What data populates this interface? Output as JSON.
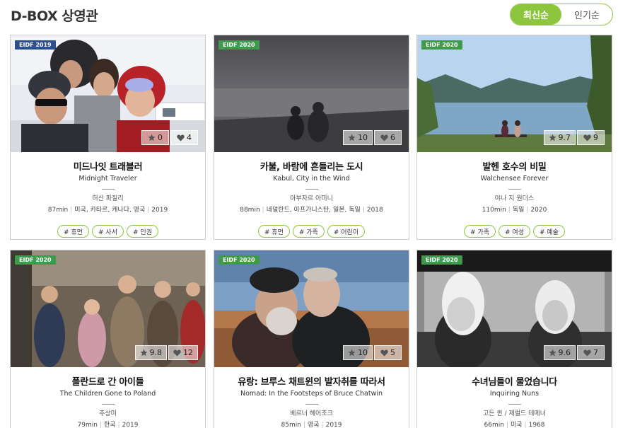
{
  "page": {
    "title": "D-BOX 상영관"
  },
  "sort": {
    "latest": "최신순",
    "popular": "인기순",
    "accent": "#8cc63f"
  },
  "cards": [
    {
      "badge": "EIDF 2019",
      "star": "0",
      "heart": "4",
      "title_ko": "미드나잇 트래블러",
      "title_en": "Midnight Traveler",
      "director": "허산 파질리",
      "runtime": "87min",
      "countries": "미국, 카타르, 캐나다, 영국",
      "year": "2019",
      "tags": [
        "# 휴먼",
        "# 사서",
        "# 인권"
      ]
    },
    {
      "badge": "EIDF 2020",
      "star": "10",
      "heart": "6",
      "title_ko": "카불, 바람에 흔들리는 도시",
      "title_en": "Kabul, City in the Wind",
      "director": "아부자르 아미니",
      "runtime": "88min",
      "countries": "네덜란드, 아프가니스탄, 일본, 독일",
      "year": "2018",
      "tags": [
        "# 휴먼",
        "# 가족",
        "# 어린이"
      ]
    },
    {
      "badge": "EIDF 2020",
      "star": "9.7",
      "heart": "9",
      "title_ko": "발헨 호수의 비밀",
      "title_en": "Walchensee Forever",
      "director": "야나 지 원더스",
      "runtime": "110min",
      "countries": "독일",
      "year": "2020",
      "tags": [
        "# 가족",
        "# 여성",
        "# 예술"
      ]
    },
    {
      "badge": "EIDF 2020",
      "star": "9.8",
      "heart": "12",
      "title_ko": "폴란드로 간 아이들",
      "title_en": "The Children Gone to Poland",
      "director": "추상미",
      "runtime": "79min",
      "countries": "한국",
      "year": "2019",
      "tags": []
    },
    {
      "badge": "EIDF 2020",
      "star": "10",
      "heart": "5",
      "title_ko": "유랑: 브루스 채트윈의 발자취를 따라서",
      "title_en": "Nomad: In the Footsteps of Bruce Chatwin",
      "director": "베르너 헤어조크",
      "runtime": "85min",
      "countries": "영국",
      "year": "2019",
      "tags": []
    },
    {
      "badge": "EIDF 2020",
      "star": "9.6",
      "heart": "7",
      "title_ko": "수녀님들이 물었습니다",
      "title_en": "Inquiring Nuns",
      "director": "고든 퀸 / 제럴드 테메너",
      "runtime": "66min",
      "countries": "미국",
      "year": "1968",
      "tags": []
    }
  ]
}
